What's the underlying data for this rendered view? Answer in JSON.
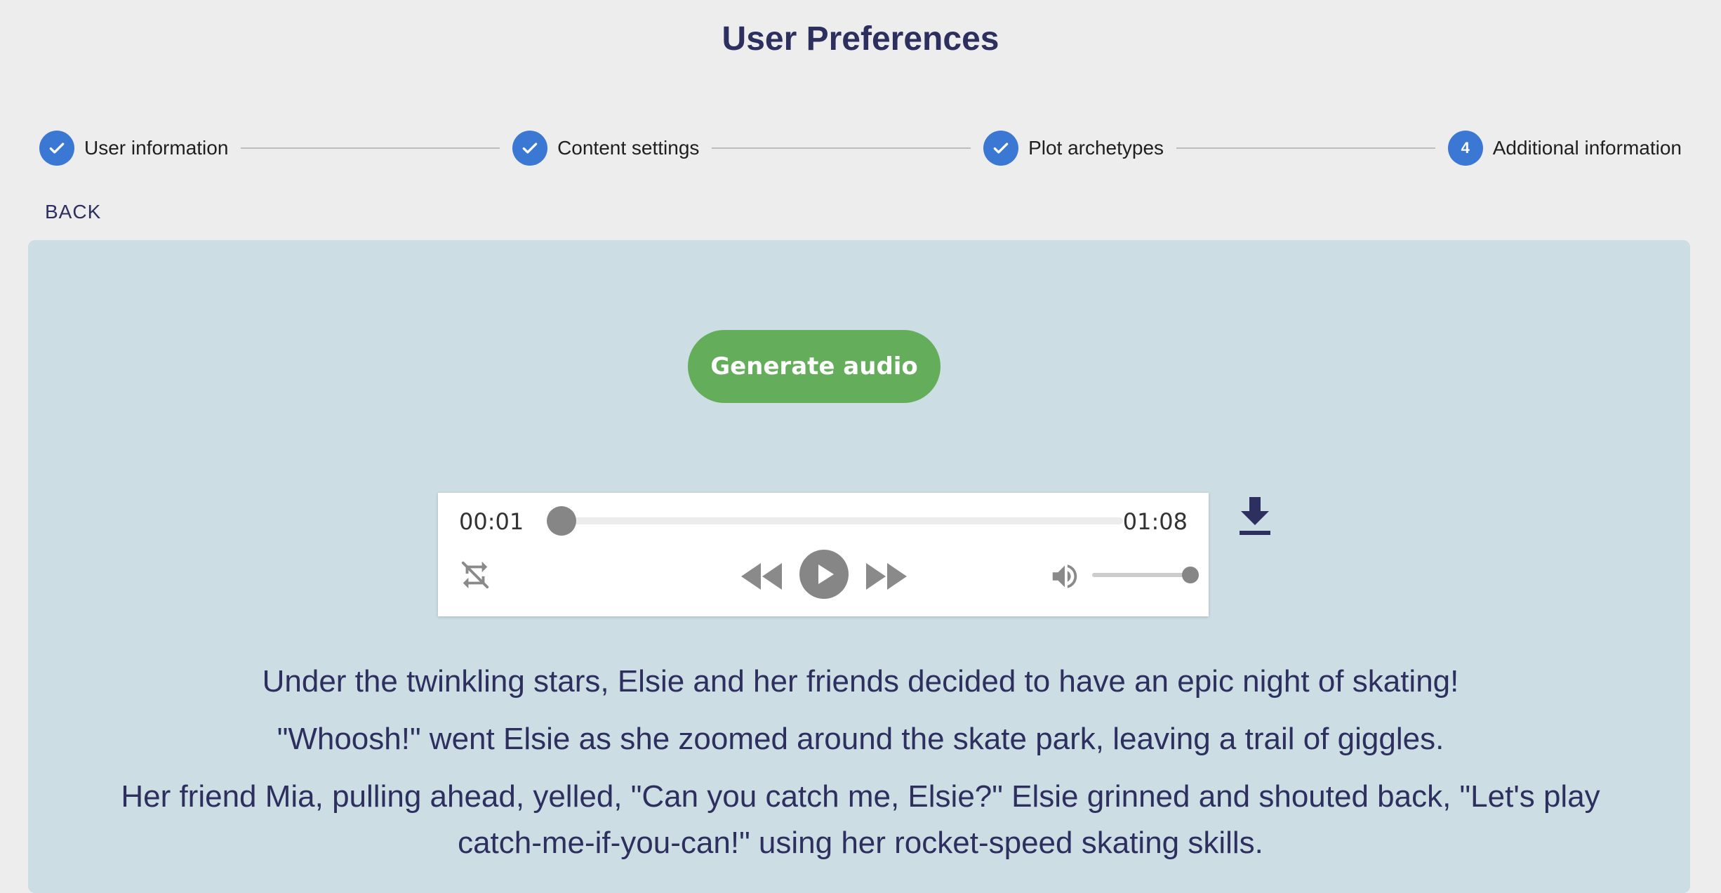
{
  "header": {
    "title": "User Preferences"
  },
  "stepper": {
    "steps": [
      {
        "label": "User information",
        "status": "completed"
      },
      {
        "label": "Content settings",
        "status": "completed"
      },
      {
        "label": "Plot archetypes",
        "status": "completed"
      },
      {
        "label": "Additional information",
        "status": "active",
        "number": "4"
      }
    ]
  },
  "nav": {
    "back_label": "BACK"
  },
  "actions": {
    "generate_audio_label": "Generate audio"
  },
  "player": {
    "current_time": "00:01",
    "total_time": "01:08",
    "progress_fraction": 0.015,
    "volume_fraction": 1.0,
    "icons": [
      "repeat-off-icon",
      "rewind-icon",
      "play-icon",
      "fast-forward-icon",
      "volume-icon",
      "download-icon"
    ]
  },
  "story": {
    "paragraphs": [
      "Under the twinkling stars, Elsie and her friends decided to have an epic night of skating!",
      "\"Whoosh!\" went Elsie as she zoomed around the skate park, leaving a trail of giggles.",
      "Her friend Mia, pulling ahead, yelled, \"Can you catch me, Elsie?\" Elsie grinned and shouted back, \"Let's play catch-me-if-you-can!\" using her rocket-speed skating skills."
    ]
  },
  "colors": {
    "primary": "#3a78d4",
    "title": "#2d2f5e",
    "generate_button": "#64ad5a",
    "panel": "#ccdde3",
    "background": "#ededed"
  }
}
